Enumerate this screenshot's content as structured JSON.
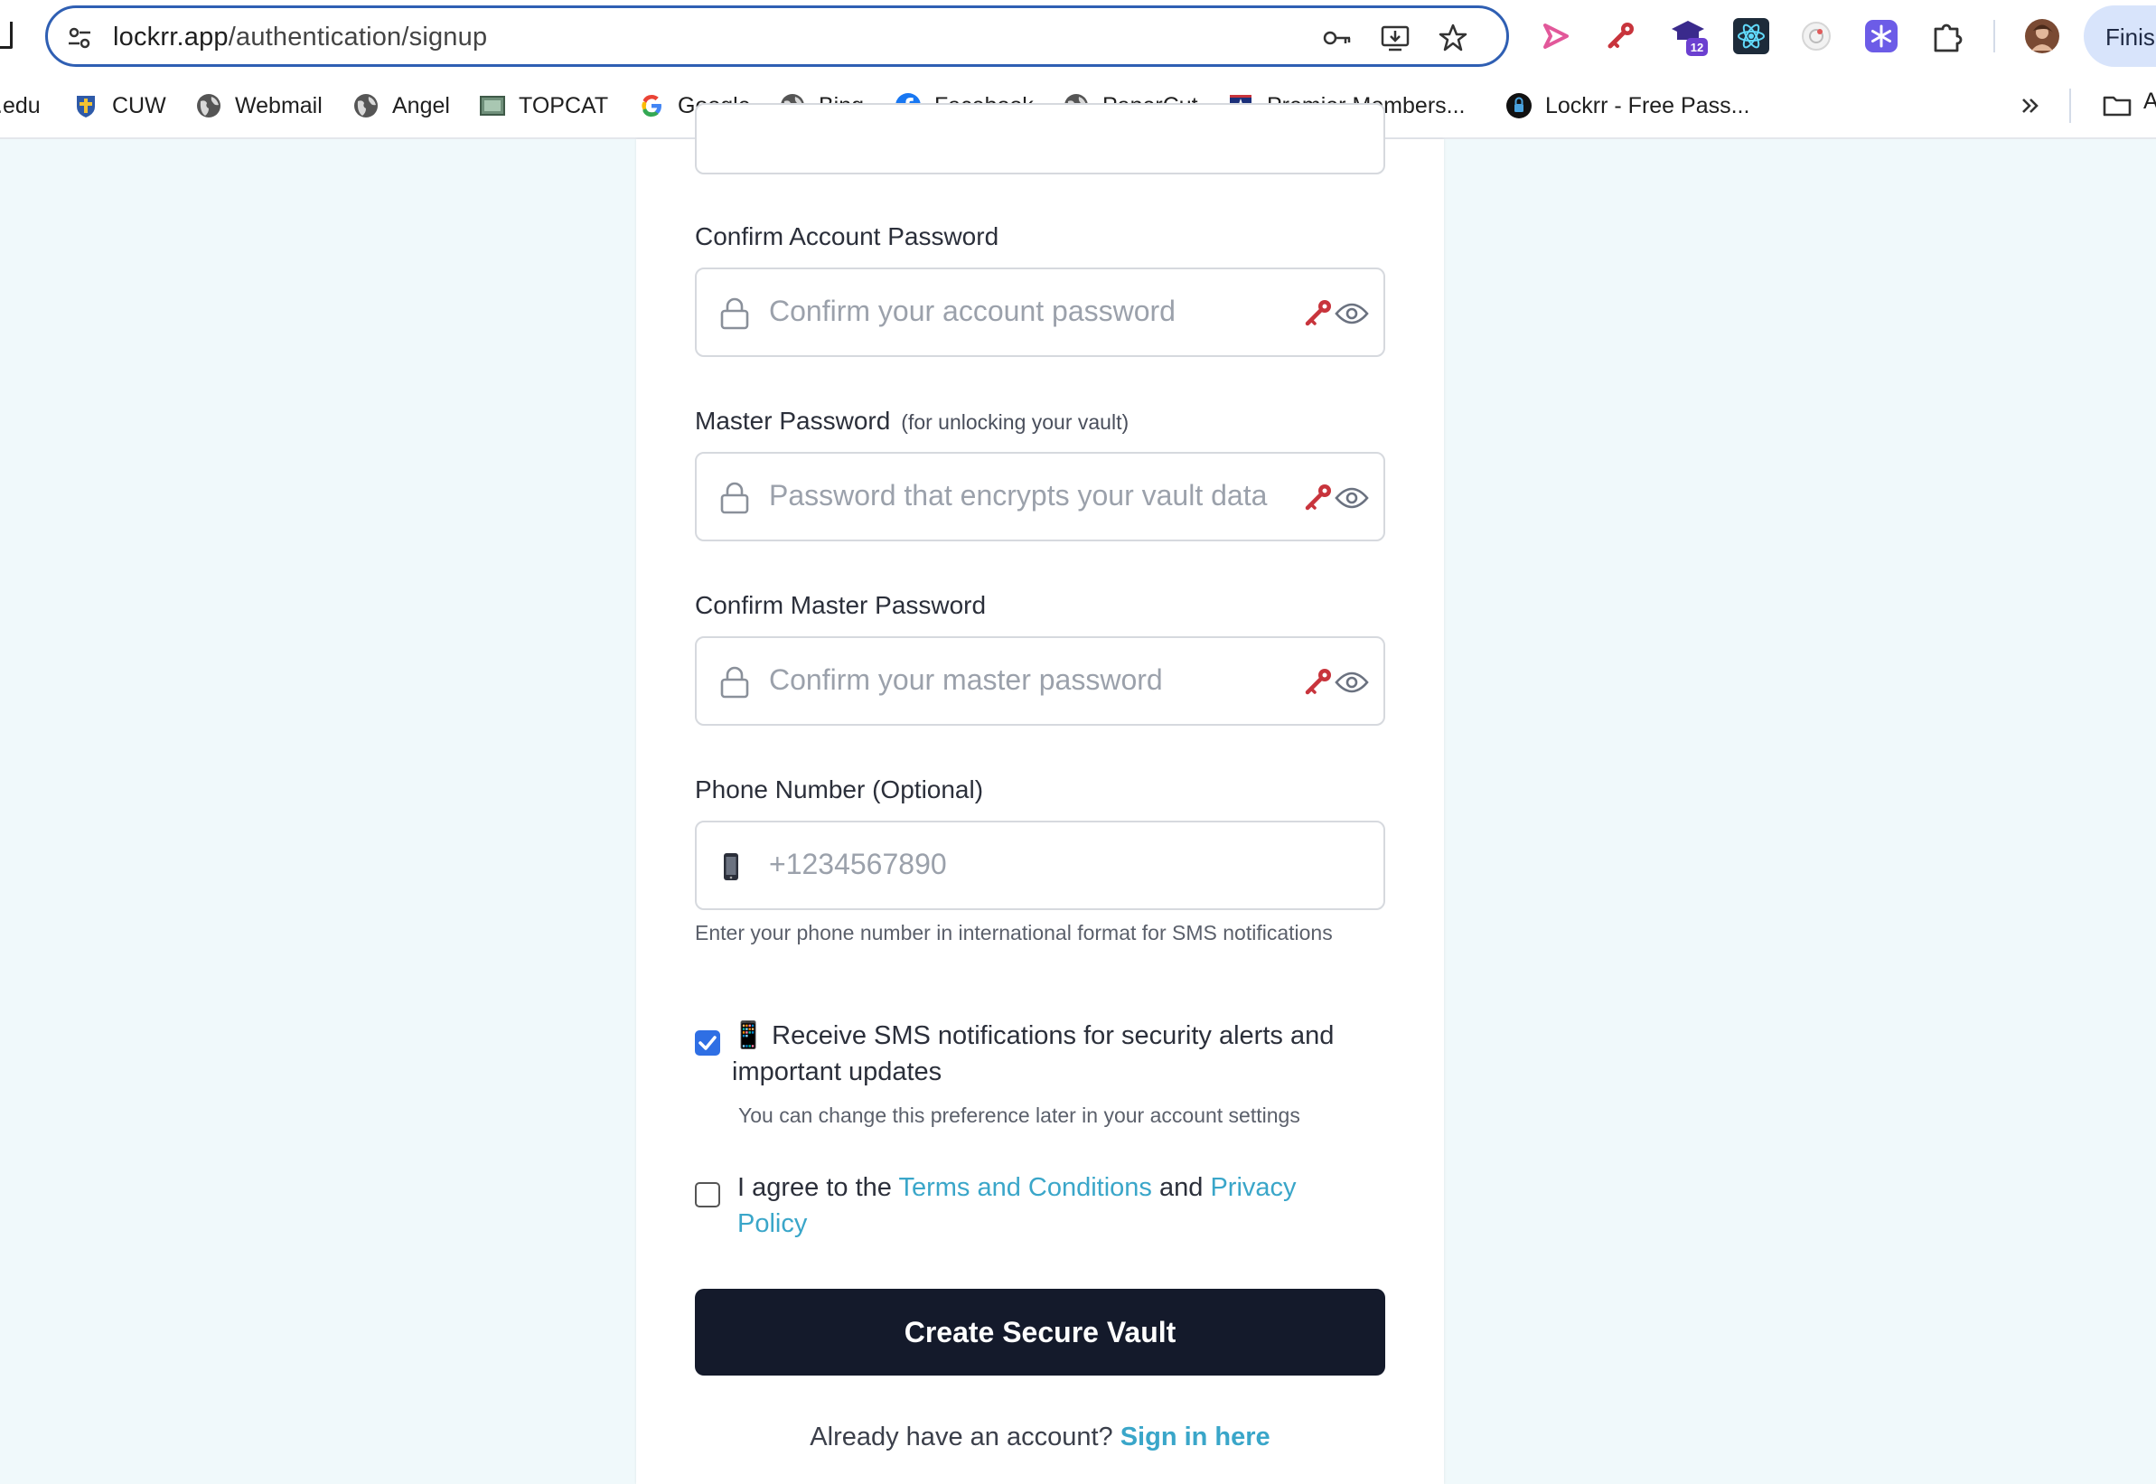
{
  "browser": {
    "url_host": "lockrr.app",
    "url_path": "/authentication/signup",
    "finish_label": "Finis",
    "extension_badge": "12"
  },
  "bookmarks": {
    "items": [
      {
        "label": ".edu",
        "icon": "none"
      },
      {
        "label": "CUW",
        "icon": "cuw-icon"
      },
      {
        "label": "Webmail",
        "icon": "globe-icon"
      },
      {
        "label": "Angel",
        "icon": "globe-icon"
      },
      {
        "label": "TOPCAT",
        "icon": "topcat-icon"
      },
      {
        "label": "Google",
        "icon": "google-icon"
      },
      {
        "label": "Bing",
        "icon": "globe-icon"
      },
      {
        "label": "Facebook",
        "icon": "facebook-icon"
      },
      {
        "label": "PaperCut",
        "icon": "globe-icon"
      },
      {
        "label": "Premier Members...",
        "icon": "star-shield-icon"
      },
      {
        "label": "Lockrr - Free Pass...",
        "icon": "lockrr-icon"
      }
    ],
    "trailing": "A"
  },
  "form": {
    "confirm_account_label": "Confirm Account Password",
    "confirm_account_placeholder": "Confirm your account password",
    "master_label": "Master Password",
    "master_sublabel": "(for unlocking your vault)",
    "master_placeholder": "Password that encrypts your vault data",
    "confirm_master_label": "Confirm Master Password",
    "confirm_master_placeholder": "Confirm your master password",
    "phone_label": "Phone Number (Optional)",
    "phone_placeholder": "+1234567890",
    "phone_hint": "Enter your phone number in international format for SMS notifications",
    "sms_checked": true,
    "sms_label_emoji": "📱",
    "sms_label": "Receive SMS notifications for security alerts and important updates",
    "sms_hint": "You can change this preference later in your account settings",
    "terms_checked": false,
    "terms_prefix": "I agree to the",
    "terms_link": "Terms and Conditions",
    "terms_and": "and",
    "privacy_link": "Privacy Policy",
    "submit_label": "Create Secure Vault",
    "signin_prefix": "Already have an account?",
    "signin_link": "Sign in here"
  },
  "colors": {
    "accent_link": "#3aa6c9",
    "primary_button": "#141a2b",
    "checkbox_checked": "#2f6fe4",
    "key_icon": "#c8343c",
    "page_background": "#f0f9fb"
  }
}
